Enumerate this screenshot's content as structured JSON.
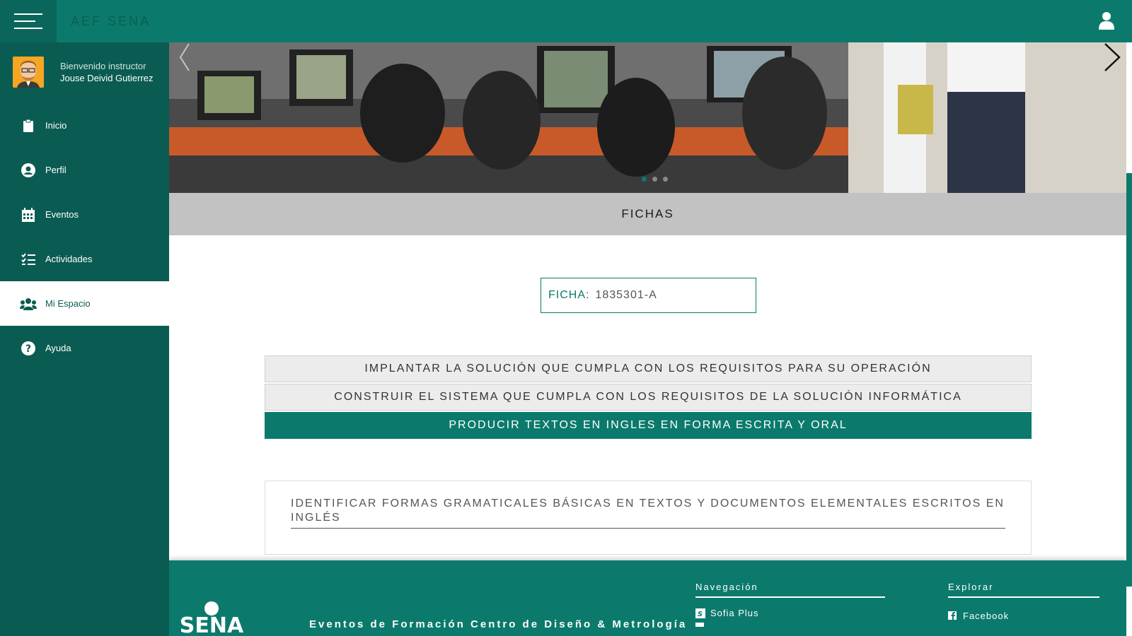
{
  "app": {
    "title": "AEF SENA"
  },
  "colors": {
    "primary": "#0b7a6c",
    "sidebar": "#0a5c52",
    "bar_gray": "#c2c2c2"
  },
  "icons": {
    "menu": "hamburger-icon",
    "user": "user-icon",
    "next": "chevron-right-icon",
    "prev": "chevron-left-icon"
  },
  "sidebar": {
    "welcome": "Bienvenido instructor",
    "username": "Jouse Deivid Gutierrez",
    "items": [
      {
        "label": "Inicio",
        "icon": "clipboard-icon"
      },
      {
        "label": "Perfil",
        "icon": "user-circle-icon"
      },
      {
        "label": "Eventos",
        "icon": "calendar-icon"
      },
      {
        "label": "Actividades",
        "icon": "checklist-icon"
      },
      {
        "label": "Mi Espacio",
        "icon": "users-icon",
        "active": true
      },
      {
        "label": "Ayuda",
        "icon": "help-icon"
      }
    ]
  },
  "main": {
    "section_title": "FICHAS",
    "ficha": {
      "label": "FICHA:",
      "value": "1835301-A"
    },
    "accordion": [
      {
        "label": "IMPLANTAR LA SOLUCIÓN QUE CUMPLA CON LOS REQUISITOS PARA SU OPERACIÓN"
      },
      {
        "label": "CONSTRUIR EL SISTEMA QUE CUMPLA CON LOS REQUISITOS DE LA SOLUCIÓN INFORMÁTICA"
      },
      {
        "label": "PRODUCIR TEXTOS EN INGLES EN FORMA ESCRITA Y ORAL",
        "open": true
      }
    ],
    "open_panel_item": "IDENTIFICAR FORMAS GRAMATICALES BÁSICAS EN TEXTOS Y DOCUMENTOS ELEMENTALES ESCRITOS EN INGLÉS"
  },
  "footer": {
    "logo_text": "SENA",
    "title": "Eventos de Formación Centro de Diseño & Metrología",
    "nav_heading": "Navegación",
    "nav_links": [
      "Sofia Plus"
    ],
    "explore_heading": "Explorar",
    "explore_links": [
      "Facebook"
    ]
  }
}
